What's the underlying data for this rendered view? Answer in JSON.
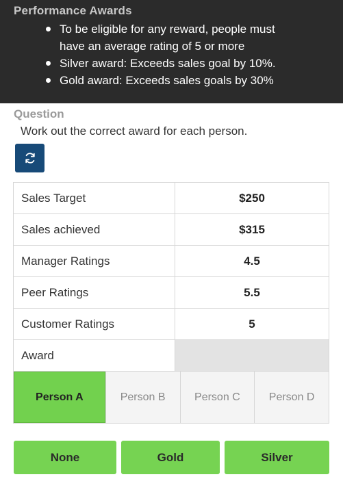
{
  "header": {
    "title": "Performance Awards",
    "rules": [
      "To be eligible for any reward, people must have an average rating of 5 or more",
      "Silver award: Exceeds sales goal by 10%.",
      "Gold award: Exceeds sales goals by 30%"
    ]
  },
  "question": {
    "label": "Question",
    "text": "Work out the correct award for each person.",
    "refresh_icon": "refresh-icon"
  },
  "table": {
    "rows": [
      {
        "label": "Sales Target",
        "value": "$250"
      },
      {
        "label": "Sales achieved",
        "value": "$315"
      },
      {
        "label": "Manager Ratings",
        "value": "4.5"
      },
      {
        "label": "Peer Ratings",
        "value": "5.5"
      },
      {
        "label": "Customer Ratings",
        "value": "5"
      },
      {
        "label": "Award",
        "value": ""
      }
    ]
  },
  "persons": {
    "selected": "Person A",
    "tabs": [
      "Person A",
      "Person B",
      "Person C",
      "Person D"
    ]
  },
  "answers": {
    "none_label": "None",
    "gold_label": "Gold",
    "silver_label": "Silver"
  },
  "colors": {
    "header_bg": "#2b2b2b",
    "refresh_bg": "#174a78",
    "accent_green": "#76d352"
  }
}
